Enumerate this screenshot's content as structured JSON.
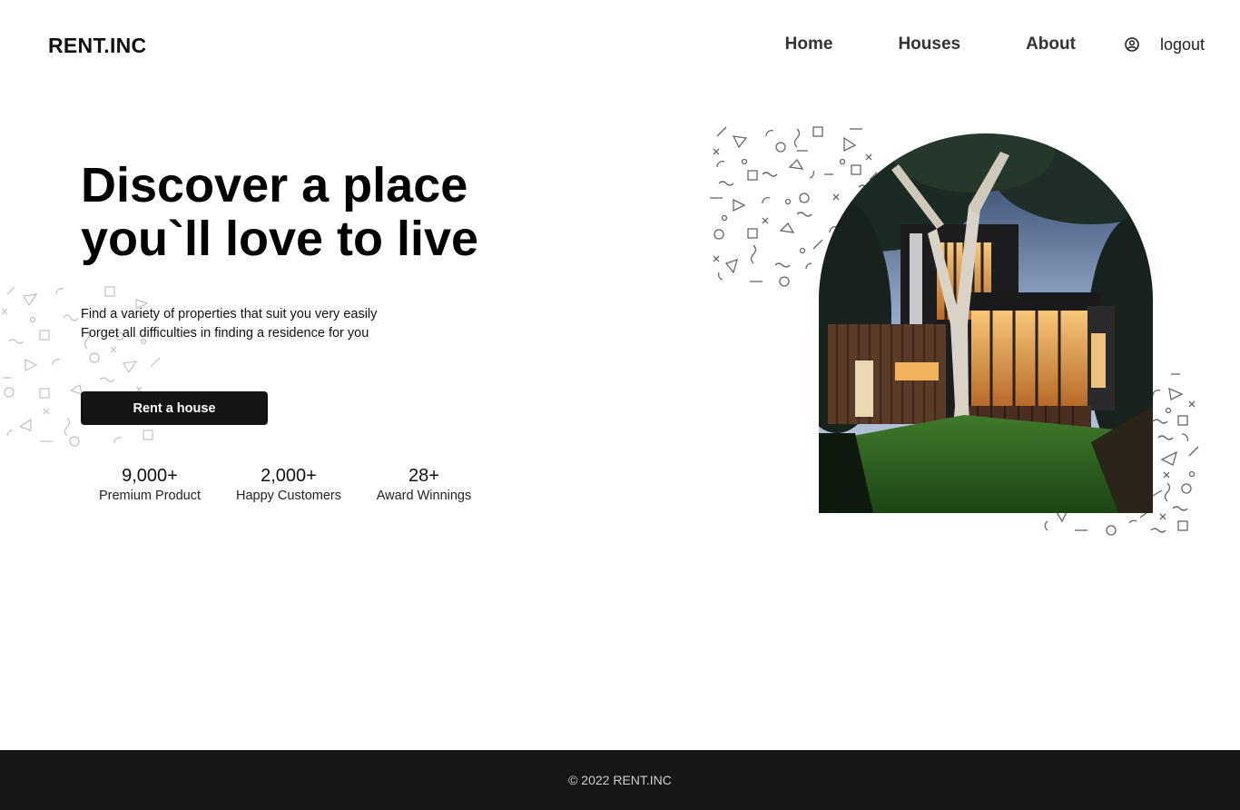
{
  "header": {
    "brand": "RENT.INC",
    "nav": {
      "home": "Home",
      "houses": "Houses",
      "about": "About",
      "logout": "logout"
    },
    "user_icon": "user-circle-icon"
  },
  "hero": {
    "title_line1": "Discover a place",
    "title_line2": "you`ll love to live",
    "subtitle_line1": "Find a variety of properties that suit you very easily",
    "subtitle_line2": "Forget all difficulties in finding a residence for you",
    "cta_label": "Rent a house",
    "stats": [
      {
        "value": "9,000+",
        "label": "Premium Product"
      },
      {
        "value": "2,000+",
        "label": "Happy Customers"
      },
      {
        "value": "28+",
        "label": "Award Winnings"
      }
    ]
  },
  "footer": {
    "copyright": "© 2022 RENT.INC"
  },
  "colors": {
    "dark": "#141414",
    "footer_bg": "#161616",
    "text": "#111111",
    "background": "#ffffff"
  }
}
